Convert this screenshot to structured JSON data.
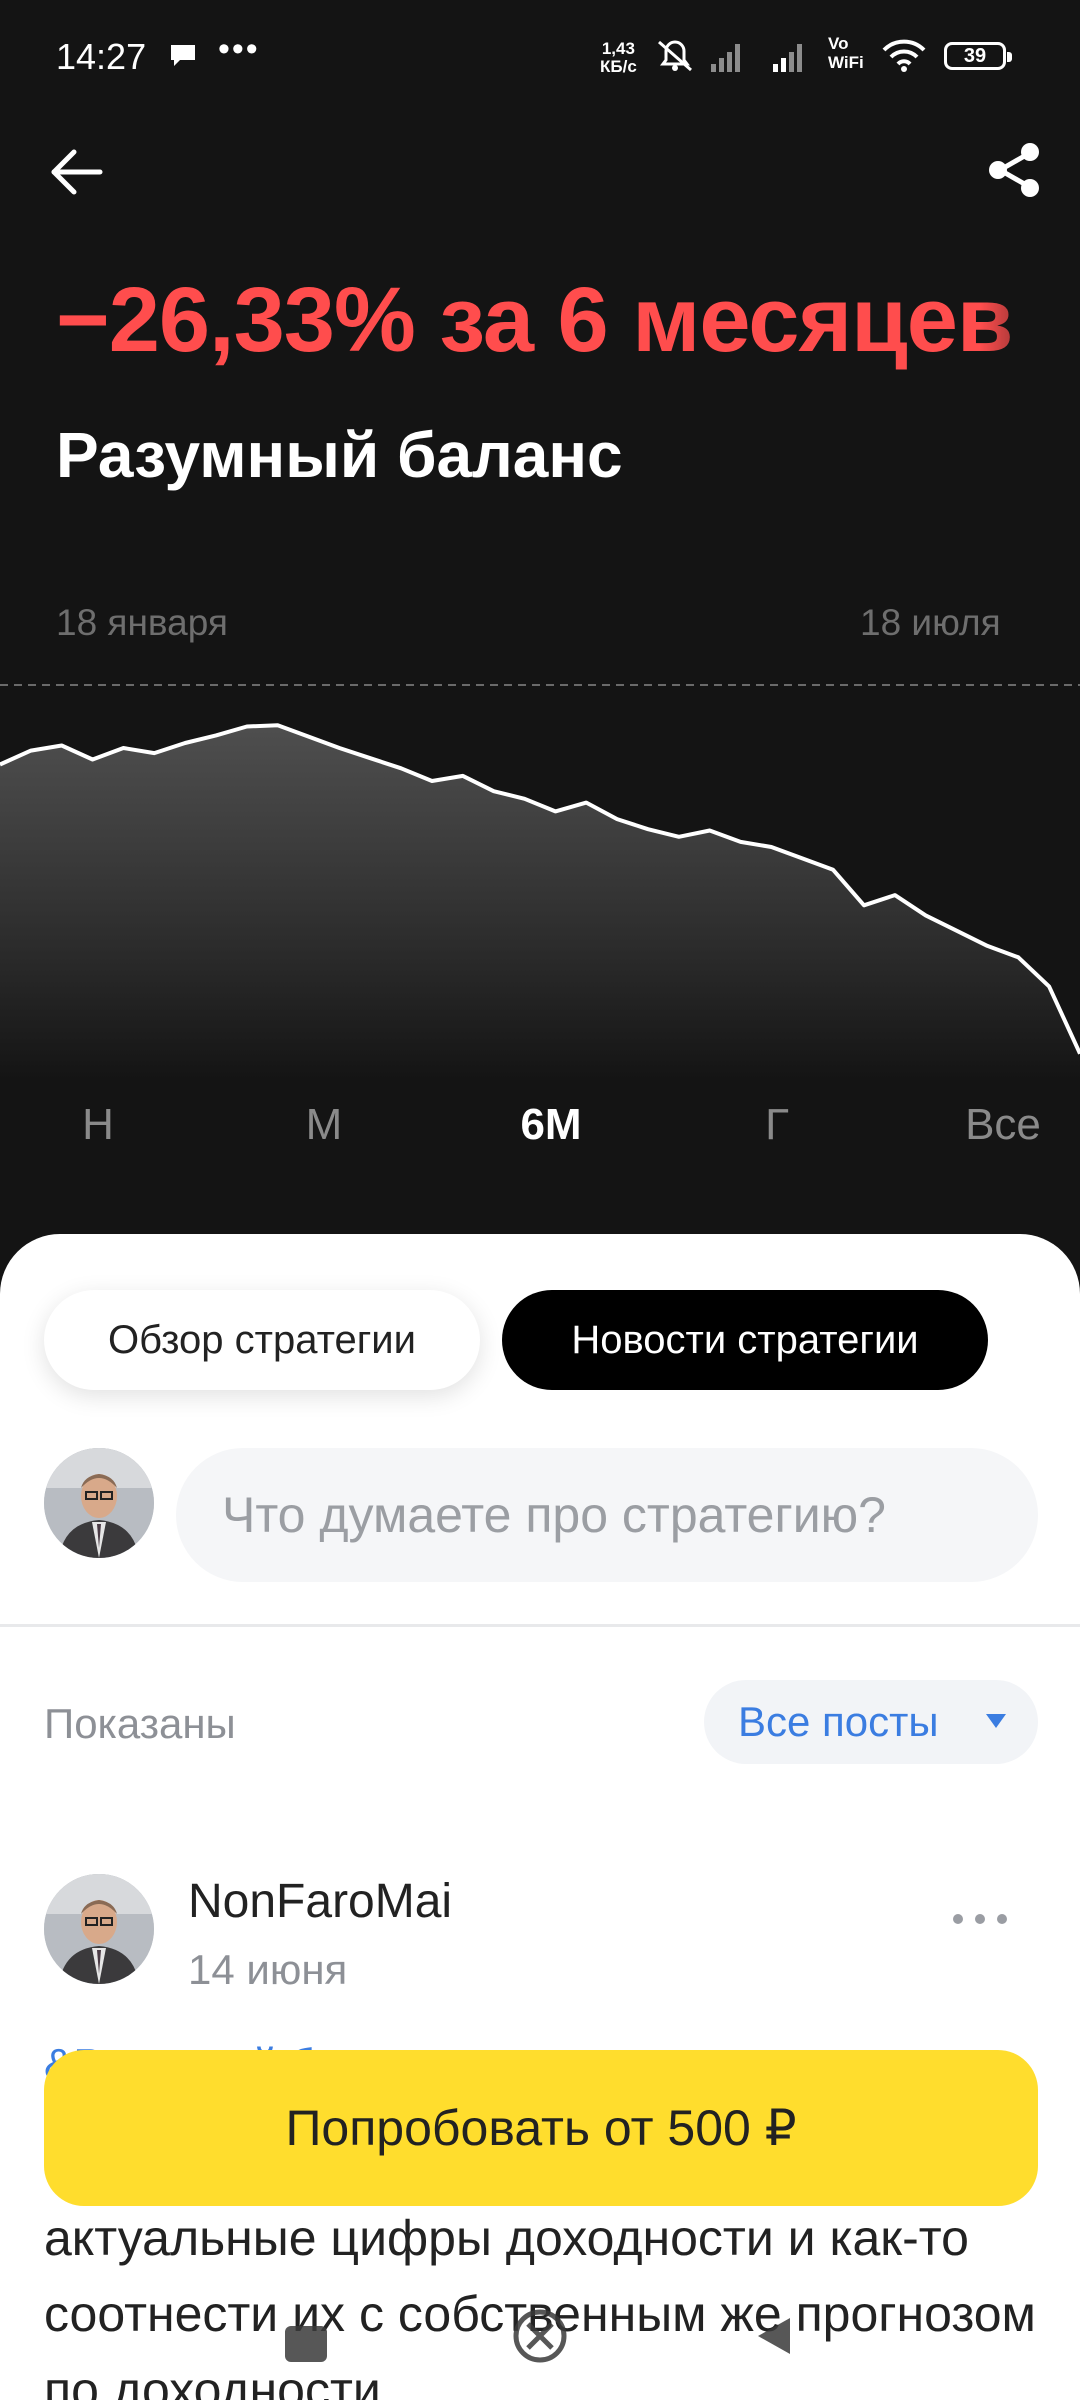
{
  "status_bar": {
    "time": "14:27",
    "network_speed_value": "1,43",
    "network_speed_unit": "КБ/с",
    "vo_top": "Vo",
    "vo_bottom": "WiFi",
    "battery": "39"
  },
  "header": {
    "change": "−26,33% за 6 месяцев",
    "title": "Разумный баланс",
    "change_color": "#ff4d4d"
  },
  "chart_data": {
    "type": "area",
    "x_start_label": "18 января",
    "x_end_label": "18 июля",
    "x": [
      "18 января",
      "",
      "",
      "",
      "",
      "",
      "",
      "",
      "",
      "",
      "",
      "",
      "",
      "",
      "",
      "",
      "",
      "",
      "",
      "",
      "",
      "",
      "",
      "",
      "",
      "",
      "",
      "",
      "",
      "",
      "",
      "",
      "",
      "",
      "",
      "18 июля"
    ],
    "values": [
      96.5,
      97.6,
      98.0,
      96.9,
      97.8,
      97.4,
      98.2,
      98.8,
      99.5,
      99.6,
      98.7,
      97.8,
      97.0,
      96.2,
      95.2,
      95.6,
      94.4,
      93.8,
      92.8,
      93.5,
      92.2,
      91.4,
      90.8,
      91.3,
      90.4,
      90.0,
      89.1,
      88.2,
      85.4,
      86.2,
      84.6,
      83.4,
      82.2,
      81.3,
      79.0,
      73.7
    ],
    "color": "#ffffff",
    "grid": false
  },
  "periods": [
    {
      "label": "Н",
      "active": false
    },
    {
      "label": "М",
      "active": false
    },
    {
      "label": "6М",
      "active": true
    },
    {
      "label": "Г",
      "active": false
    },
    {
      "label": "Все",
      "active": false
    }
  ],
  "tabs": {
    "overview": "Обзор стратегии",
    "news": "Новости стратегии"
  },
  "comment": {
    "placeholder": "Что думаете про стратегию?"
  },
  "filter": {
    "shown_label": "Показаны",
    "selected": "Все посты"
  },
  "post": {
    "author": "NonFaroMai",
    "date": "14 июня",
    "tag": "&Разумный баланс",
    "text": "актуальные цифры доходности и как-то соотнести их с собственным же прогнозом по доходности"
  },
  "cta": {
    "label": "Попробовать от 500 ₽",
    "color": "#ffdd2d"
  },
  "icons": {
    "back": "arrow-left-icon",
    "share": "share-icon",
    "menu": "more-horizontal-icon"
  }
}
